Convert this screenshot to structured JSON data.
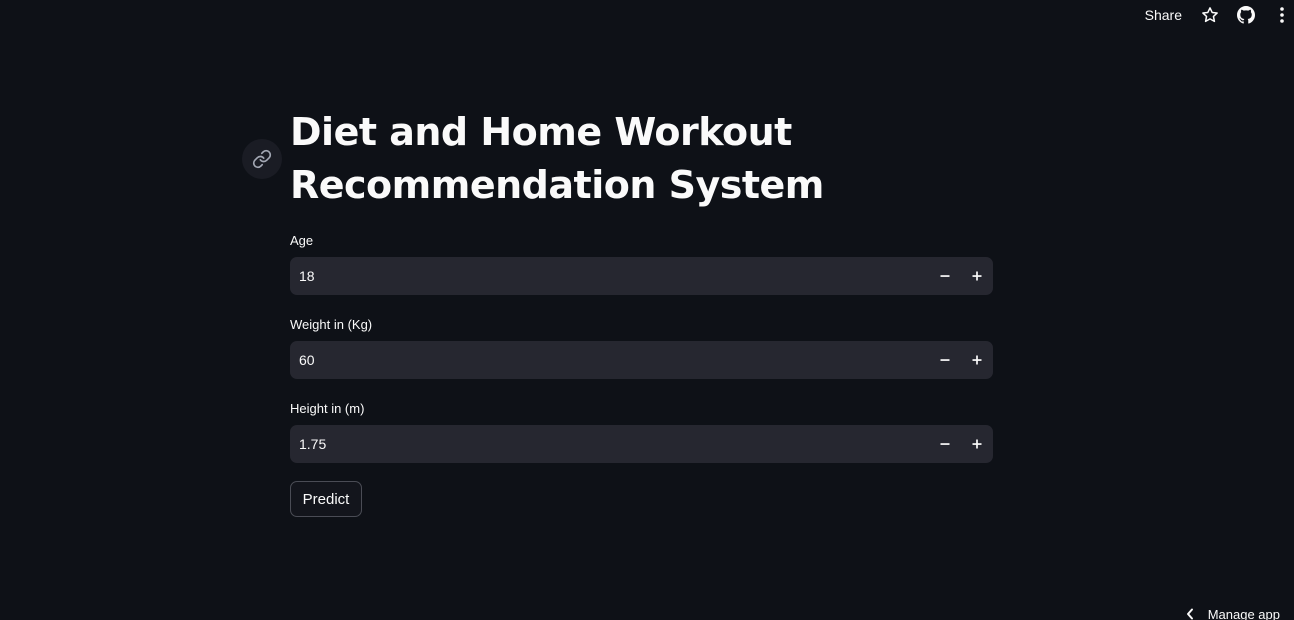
{
  "toolbar": {
    "share_label": "Share",
    "icons": [
      "star-icon",
      "github-icon",
      "more-vert-icon"
    ]
  },
  "header": {
    "title_line1": "Diet and Home Workout",
    "title_line2": "Recommendation System",
    "anchor_icon": "link-icon"
  },
  "form": {
    "age": {
      "label": "Age",
      "value": "18"
    },
    "weight": {
      "label": "Weight in (Kg)",
      "value": "60"
    },
    "height": {
      "label": "Height in (m)",
      "value": "1.75"
    },
    "predict_label": "Predict"
  },
  "footer": {
    "manage_app_label": "Manage app"
  },
  "colors": {
    "background": "#0e1117",
    "input_bg": "#262730",
    "text": "#fafafa"
  }
}
